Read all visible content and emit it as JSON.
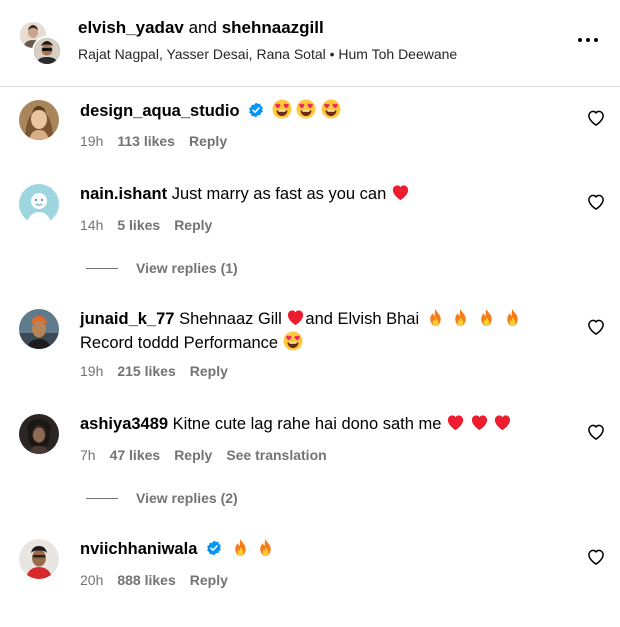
{
  "header": {
    "user1": "elvish_yadav",
    "connector": "and",
    "user2": "shehnaazgill",
    "subtitle": "Rajat Nagpal, Yasser Desai, Rana Sotal • Hum Toh Deewane"
  },
  "comments": [
    {
      "username": "design_aqua_studio",
      "verified": true,
      "text": "",
      "emojis": [
        "heart-eyes",
        "heart-eyes",
        "heart-eyes"
      ],
      "time": "19h",
      "likes": "113 likes",
      "reply": "Reply"
    },
    {
      "username": "nain.ishant",
      "verified": false,
      "text": "Just marry as fast as you can",
      "emojis": [
        "red-heart"
      ],
      "time": "14h",
      "likes": "5 likes",
      "reply": "Reply",
      "view_replies": "View replies (1)"
    },
    {
      "username": "junaid_k_77",
      "verified": false,
      "text_part1": "Shehnaaz Gill",
      "text_part2": "and Elvish Bhai",
      "text_part3": "Record toddd Performance",
      "time": "19h",
      "likes": "215 likes",
      "reply": "Reply"
    },
    {
      "username": "ashiya3489",
      "verified": false,
      "text": "Kitne cute lag rahe hai dono sath me",
      "emojis": [
        "red-heart",
        "red-heart",
        "red-heart"
      ],
      "time": "7h",
      "likes": "47 likes",
      "reply": "Reply",
      "translation": "See translation",
      "view_replies": "View replies (2)"
    },
    {
      "username": "nviichhaniwala",
      "verified": true,
      "text": "",
      "emojis": [
        "fire",
        "fire"
      ],
      "time": "20h",
      "likes": "888 likes",
      "reply": "Reply"
    }
  ],
  "colors": {
    "text": "#000000",
    "meta": "#737373",
    "verified": "#0095f6",
    "heart": "#ed1c2e"
  }
}
